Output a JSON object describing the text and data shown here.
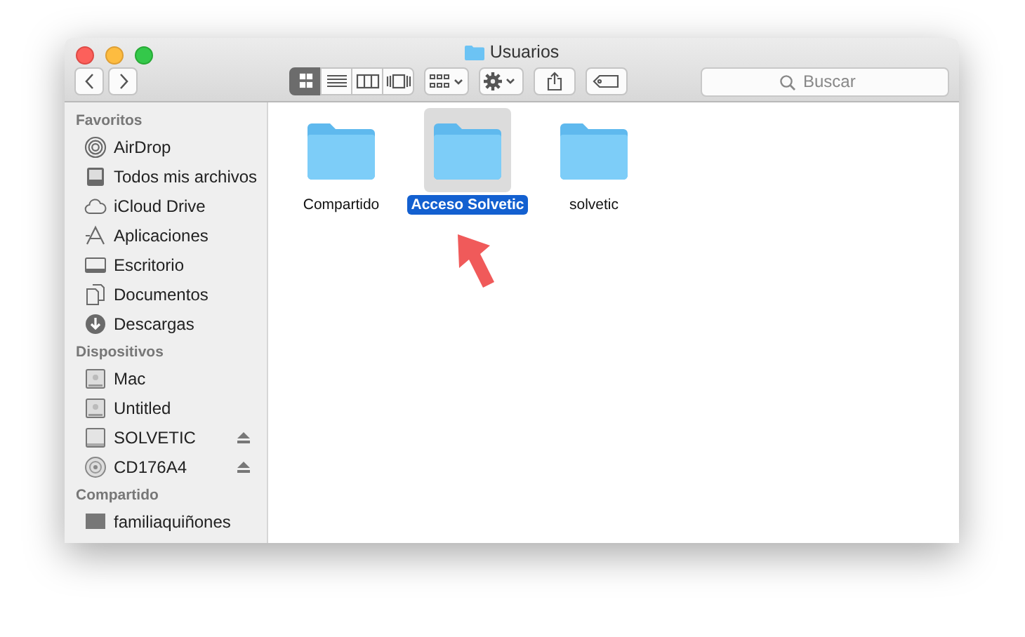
{
  "window": {
    "title": "Usuarios"
  },
  "toolbar": {
    "views": [
      {
        "kind": "icons",
        "selected": true
      },
      {
        "kind": "list",
        "selected": false
      },
      {
        "kind": "columns",
        "selected": false
      },
      {
        "kind": "coverflow",
        "selected": false
      }
    ],
    "search": {
      "placeholder": "Buscar"
    }
  },
  "sidebar": {
    "sections": [
      {
        "heading": "Favoritos",
        "items": [
          {
            "label": "AirDrop",
            "kind": "airdrop",
            "eject": false
          },
          {
            "label": "Todos mis archivos",
            "kind": "allfiles",
            "eject": false
          },
          {
            "label": "iCloud Drive",
            "kind": "cloud",
            "eject": false
          },
          {
            "label": "Aplicaciones",
            "kind": "apps",
            "eject": false
          },
          {
            "label": "Escritorio",
            "kind": "desktop",
            "eject": false
          },
          {
            "label": "Documentos",
            "kind": "documents",
            "eject": false
          },
          {
            "label": "Descargas",
            "kind": "download",
            "eject": false
          }
        ]
      },
      {
        "heading": "Dispositivos",
        "items": [
          {
            "label": "Mac",
            "kind": "disk",
            "eject": false
          },
          {
            "label": "Untitled",
            "kind": "disk",
            "eject": false
          },
          {
            "label": "SOLVETIC",
            "kind": "drive",
            "eject": true
          },
          {
            "label": "CD176A4",
            "kind": "cd",
            "eject": true
          }
        ]
      },
      {
        "heading": "Compartido",
        "items": [
          {
            "label": "familiaquiñones",
            "kind": "shared",
            "eject": false
          }
        ]
      }
    ]
  },
  "files": [
    {
      "name": "Compartido",
      "selected": false
    },
    {
      "name": "Acceso Solvetic",
      "selected": true
    },
    {
      "name": "solvetic",
      "selected": false
    }
  ]
}
